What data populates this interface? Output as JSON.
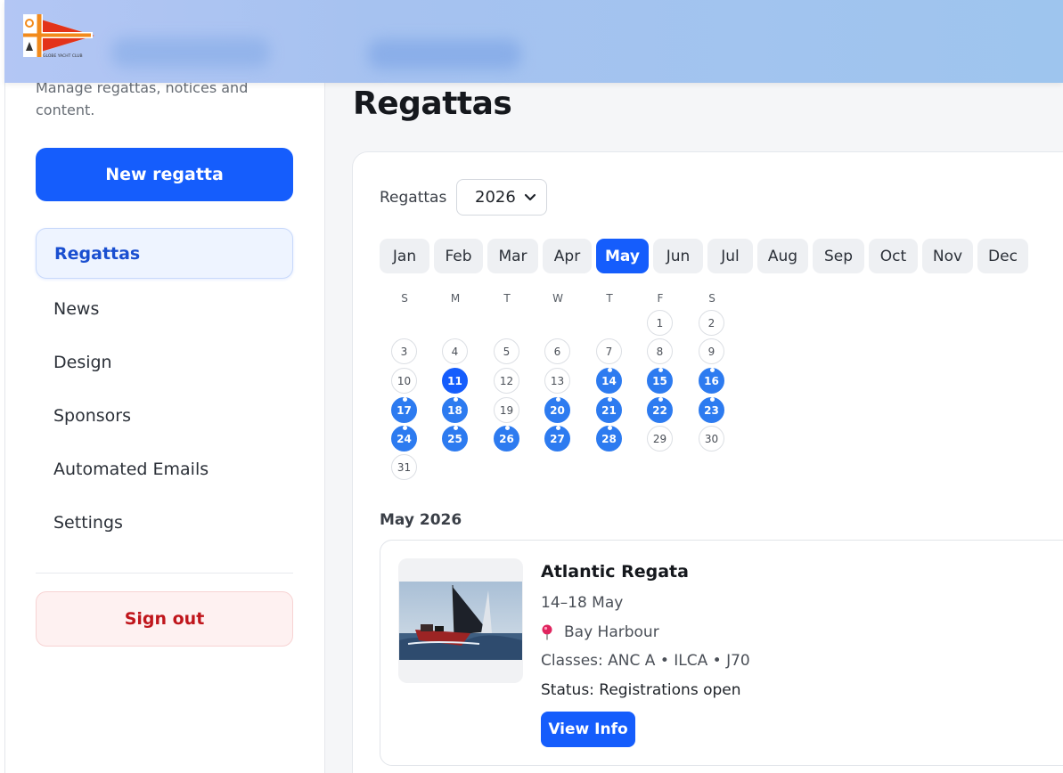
{
  "header": {
    "logo_icon": "burgee-logo",
    "logo_caption": "GLOBE YACHT CLUB"
  },
  "sidebar": {
    "description": "Manage regattas, notices and content.",
    "new_button": "New regatta",
    "items": [
      {
        "label": "Regattas",
        "active": true
      },
      {
        "label": "News",
        "active": false
      },
      {
        "label": "Design",
        "active": false
      },
      {
        "label": "Sponsors",
        "active": false
      },
      {
        "label": "Automated Emails",
        "active": false
      },
      {
        "label": "Settings",
        "active": false
      }
    ],
    "sign_out": "Sign out"
  },
  "main": {
    "title": "Regattas",
    "year_label": "Regattas",
    "year_value": "2026",
    "months": [
      "Jan",
      "Feb",
      "Mar",
      "Apr",
      "May",
      "Jun",
      "Jul",
      "Aug",
      "Sep",
      "Oct",
      "Nov",
      "Dec"
    ],
    "active_month": "May",
    "weekdays": [
      "S",
      "M",
      "T",
      "W",
      "T",
      "F",
      "S"
    ],
    "calendar_days": [
      "1",
      "2",
      "3",
      "4",
      "5",
      "6",
      "7",
      "8",
      "9",
      "10",
      "11",
      "12",
      "13",
      "14",
      "15",
      "16",
      "17",
      "18",
      "19",
      "20",
      "21",
      "22",
      "23",
      "24",
      "25",
      "26",
      "27",
      "28",
      "29",
      "30",
      "31"
    ],
    "month_heading": "May 2026",
    "event": {
      "title": "Atlantic Regata",
      "dates": "14–18 May",
      "location": "Bay Harbour",
      "classes": "Classes: ANC A • ILCA • J70",
      "status": "Status: Registrations open",
      "button": "View Info"
    }
  },
  "colors": {
    "accent": "#155dfc",
    "event_day": "#2d7bf0",
    "danger": "#c0161c"
  }
}
